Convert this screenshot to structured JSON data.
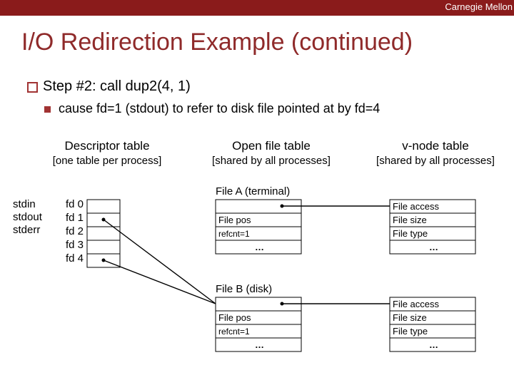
{
  "brand": "Carnegie Mellon",
  "title": "I/O Redirection Example (continued)",
  "step_line": "Step #2: call dup2(4, 1)",
  "sub_line": "cause fd=1 (stdout) to refer to disk file pointed at by fd=4",
  "columns": {
    "desc": {
      "t1": "Descriptor table",
      "t2": "[one table per process]"
    },
    "oft": {
      "t1": "Open file table",
      "t2": "[shared by all processes]"
    },
    "vnode": {
      "t1": "v-node table",
      "t2": "[shared by all processes]"
    }
  },
  "std_labels": {
    "l0": "stdin",
    "l1": "stdout",
    "l2": "stderr"
  },
  "fd_labels": {
    "f0": "fd 0",
    "f1": "fd 1",
    "f2": "fd 2",
    "f3": "fd 3",
    "f4": "fd 4"
  },
  "file_a_title": "File A (terminal)",
  "file_b_title": "File B (disk)",
  "oft_rows": {
    "r1": "",
    "r2": "File pos",
    "r3": "refcnt=1",
    "r4": "…"
  },
  "vnode_rows": {
    "r1": "File access",
    "r2": "File size",
    "r3": "File type",
    "r4": "…"
  }
}
